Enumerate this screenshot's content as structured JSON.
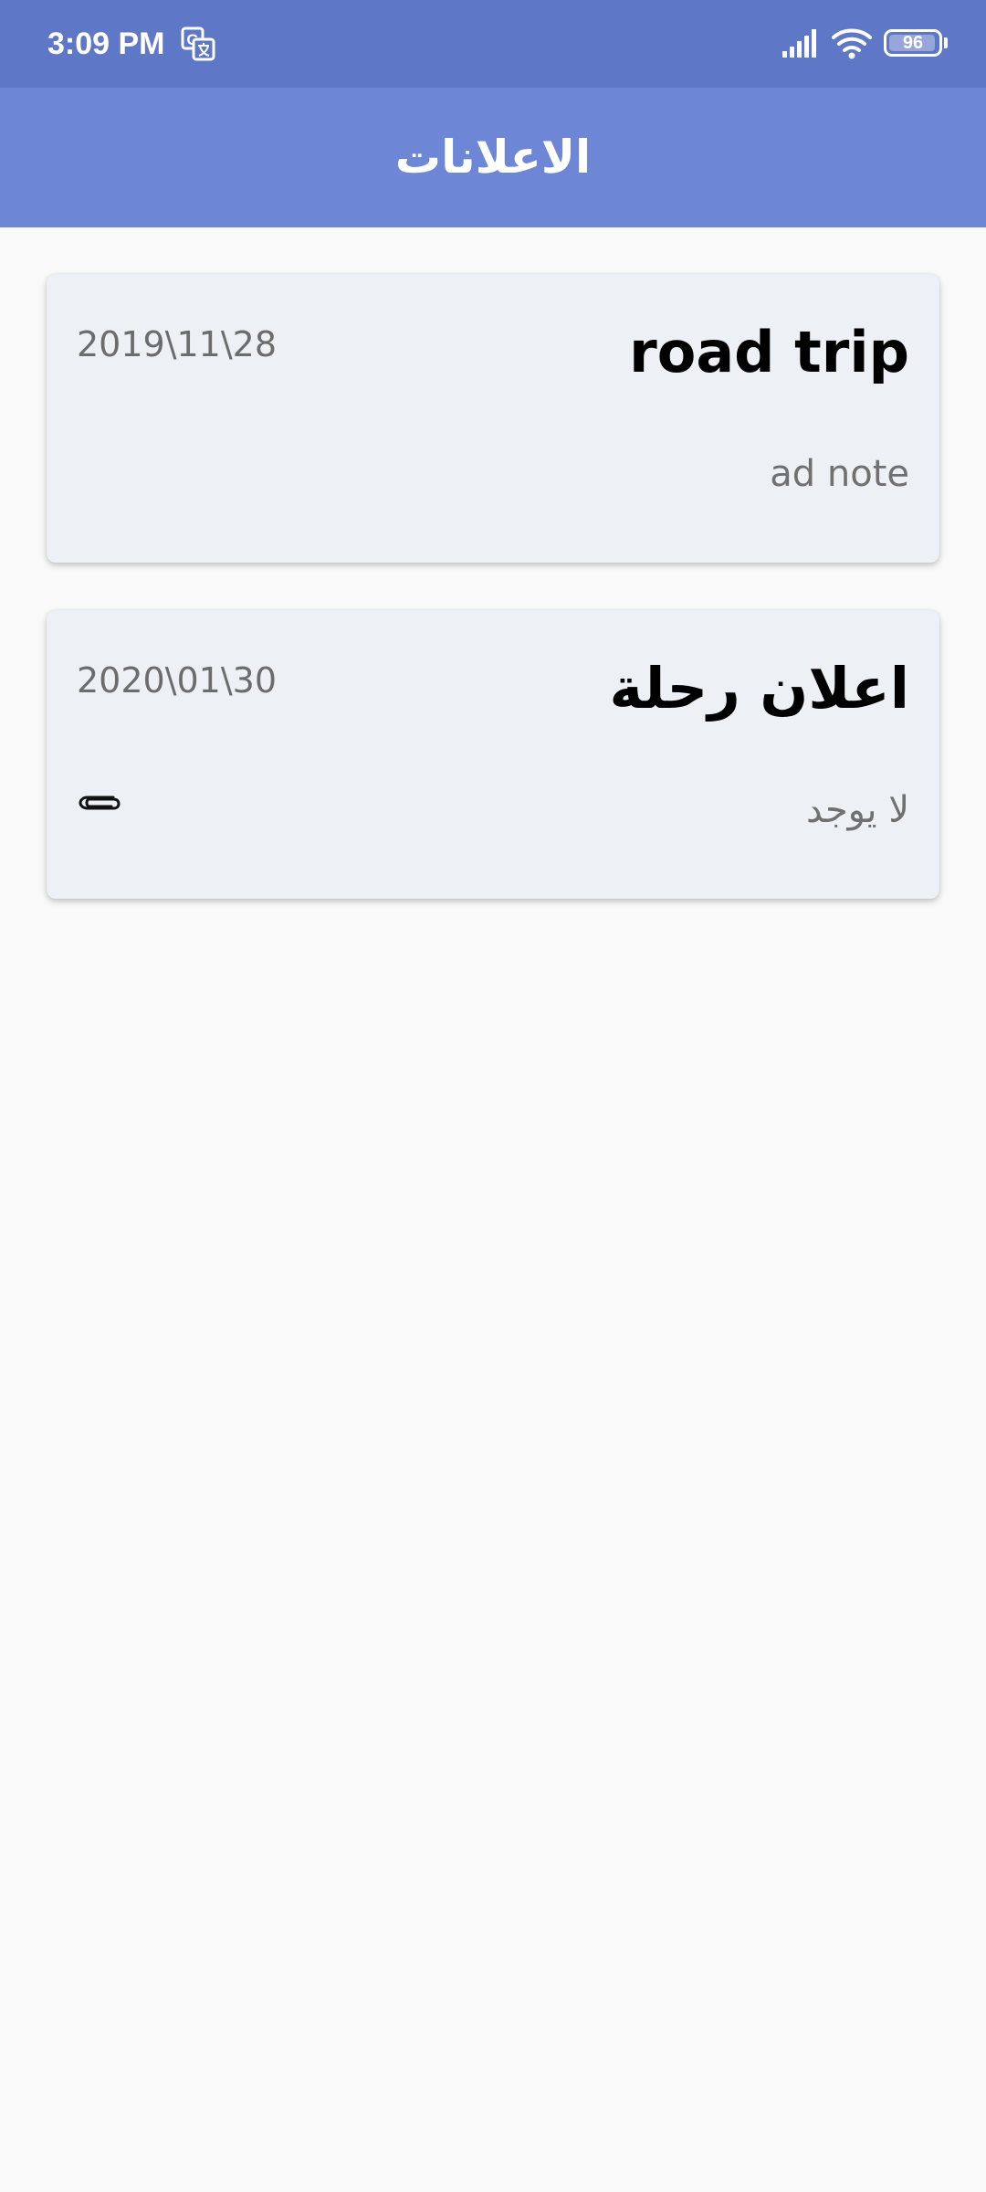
{
  "status_bar": {
    "time": "3:09 PM",
    "battery_level": 96,
    "battery_text": "96",
    "icons": [
      "translate-icon",
      "signal-icon",
      "wifi-icon",
      "battery-icon"
    ]
  },
  "app_bar": {
    "title": "الاعلانات"
  },
  "announcements": [
    {
      "title": "road trip",
      "date": "2019\\11\\28",
      "note": "ad note",
      "has_attachment": false
    },
    {
      "title": "اعلان رحلة",
      "date": "2020\\01\\30",
      "note": "لا يوجد",
      "has_attachment": true,
      "attachment_icon": "paperclip-icon"
    }
  ],
  "colors": {
    "status_bar": "#5f77c7",
    "app_bar": "#6d86d6",
    "card_background": "#edf0f4",
    "page_background": "#f9f9f9"
  }
}
